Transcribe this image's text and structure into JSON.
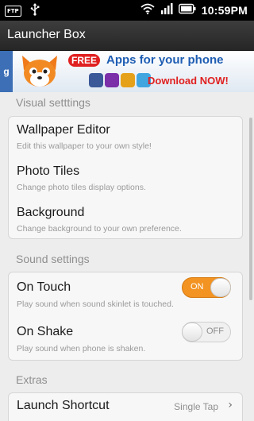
{
  "status_bar": {
    "ftp_label": "FTP",
    "usb_icon": "usb-icon",
    "wifi_icon": "wifi-icon",
    "signal_icon": "signal-icon",
    "battery_icon": "battery-icon",
    "time": "10:59PM"
  },
  "titlebar": {
    "title": "Launcher Box"
  },
  "ad": {
    "g_label": "g",
    "free_label": "FREE",
    "apps_label": "Apps for your phone",
    "download_label": "Download NOW!"
  },
  "sections": {
    "visual": {
      "header": "Visual setttings",
      "items": [
        {
          "title": "Wallpaper Editor",
          "subtitle": "Edit this wallpaper to your own style!"
        },
        {
          "title": "Photo Tiles",
          "subtitle": "Change photo tiles display options."
        },
        {
          "title": "Background",
          "subtitle": "Change background to your own preference."
        }
      ]
    },
    "sound": {
      "header": "Sound settings",
      "items": [
        {
          "title": "On Touch",
          "subtitle": "Play sound when sound skinlet is touched.",
          "toggle_label": "ON",
          "enabled": true
        },
        {
          "title": "On Shake",
          "subtitle": "Play sound when phone is shaken.",
          "toggle_label": "OFF",
          "enabled": false
        }
      ]
    },
    "extras": {
      "header": "Extras",
      "items": [
        {
          "title": "Launch Shortcut",
          "value": "Single Tap",
          "chevron": "›"
        }
      ]
    }
  },
  "colors": {
    "toggle_on": "#f29322",
    "background": "#ededed",
    "card": "#f7f7f7"
  }
}
